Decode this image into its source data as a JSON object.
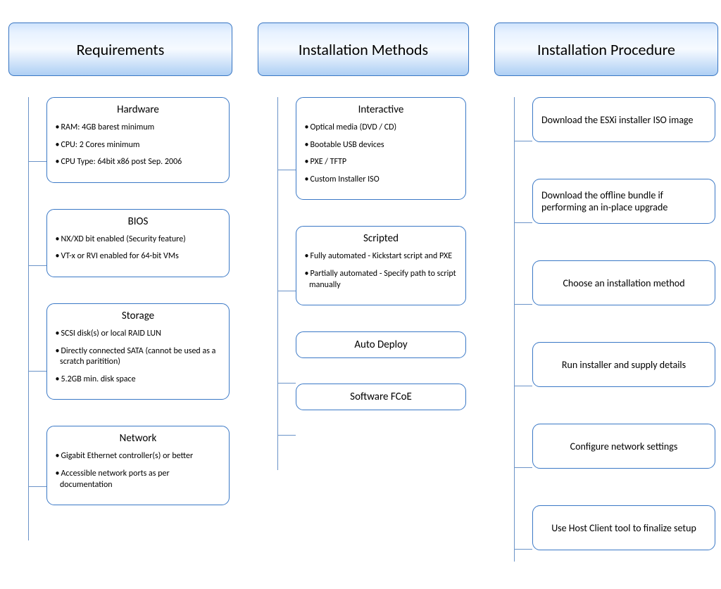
{
  "columns": [
    {
      "header": "Requirements",
      "cards": [
        {
          "title": "Hardware",
          "bullets": [
            "RAM: 4GB barest minimum",
            "CPU: 2 Cores minimum",
            "CPU Type:  64bit x86 post Sep. 2006"
          ]
        },
        {
          "title": "BIOS",
          "bullets": [
            "NX/XD bit enabled (Security feature)",
            "VT-x or RVI enabled for 64-bit VMs"
          ]
        },
        {
          "title": "Storage",
          "bullets": [
            "SCSI disk(s) or local RAID LUN",
            "Directly connected SATA (cannot be used as a scratch paritition)",
            "5.2GB min. disk space"
          ]
        },
        {
          "title": "Network",
          "bullets": [
            "Gigabit Ethernet controller(s) or better",
            "Accessible network ports as per documentation"
          ]
        }
      ]
    },
    {
      "header": "Installation Methods",
      "cards": [
        {
          "title": "Interactive",
          "bullets": [
            "Optical media (DVD / CD)",
            "Bootable USB devices",
            "PXE / TFTP",
            "Custom Installer ISO"
          ]
        },
        {
          "title": "Scripted",
          "bullets": [
            "Fully automated - Kickstart script and PXE",
            "Partially automated - Specify path to script manually"
          ]
        },
        {
          "title": "Auto Deploy",
          "simple": true
        },
        {
          "title": "Software FCoE",
          "simple": true
        }
      ]
    },
    {
      "header": "Installation Procedure",
      "steps": [
        "Download the ESXi installer ISO image",
        "Download the offline bundle if performing an in-place upgrade",
        "Choose an installation method",
        "Run installer and supply details",
        "Configure network settings",
        "Use Host Client tool to finalize setup"
      ]
    }
  ]
}
